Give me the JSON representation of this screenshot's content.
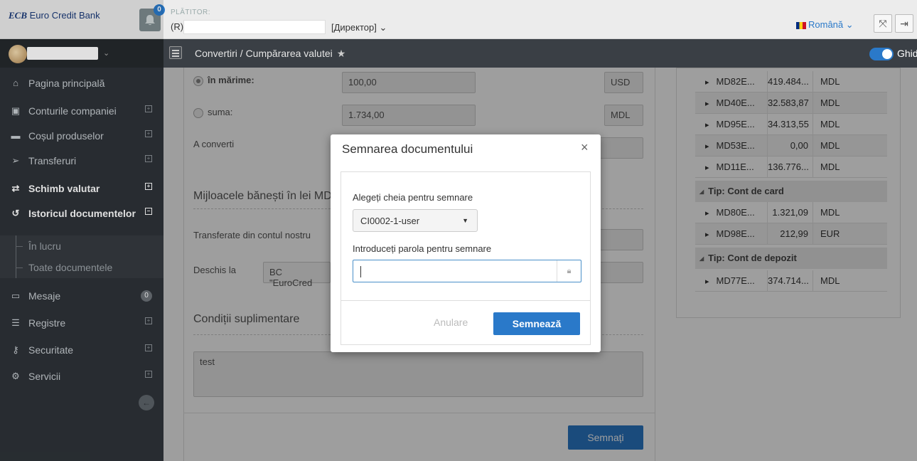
{
  "header": {
    "logo_text": "Euro Credit Bank",
    "notifications_count": "0",
    "payer_label": "PLĂTITOR:",
    "payer_prefix": "(R)",
    "role": "[Директор] ⌄",
    "language": "Română ⌄"
  },
  "sidebar": {
    "items": [
      {
        "icon": "home-icon",
        "label": "Pagina principală"
      },
      {
        "icon": "accounts-icon",
        "label": "Conturile companiei"
      },
      {
        "icon": "briefcase-icon",
        "label": "Coșul produselor"
      },
      {
        "icon": "send-icon",
        "label": "Transferuri"
      },
      {
        "icon": "exchange-icon",
        "label": "Schimb valutar"
      },
      {
        "icon": "history-icon",
        "label": "Istoricul documentelor"
      },
      {
        "icon": "inbox-icon",
        "label": "Mesaje"
      },
      {
        "icon": "list-icon",
        "label": "Registre"
      },
      {
        "icon": "key-icon",
        "label": "Securitate"
      },
      {
        "icon": "cogs-icon",
        "label": "Servicii"
      }
    ],
    "sub_items": [
      "În lucru",
      "Toate documentele"
    ],
    "messages_count": "0"
  },
  "breadcrumb": {
    "path": "Convertiri / Cumpărarea valutei",
    "guide_label": "Ghid"
  },
  "form": {
    "amount_label": "în mărime:",
    "amount_value": "100,00",
    "amount_currency": "USD",
    "sum_label": "suma:",
    "sum_value": "1.734,00",
    "sum_currency": "MDL",
    "convert_label": "A converti",
    "section_funds": "Mijloacele bănești în lei MD",
    "transferred_label": "Transferate din contul nostru",
    "opened_label": "Deschis la",
    "opened_value": "BC \"EuroCred",
    "section_conditions": "Condiții suplimentare",
    "conditions_value": "test",
    "submit_label": "Semnați"
  },
  "accounts": {
    "rows_top": [
      {
        "iban": "MD82E...",
        "amount": "419.484...",
        "currency": "MDL"
      },
      {
        "iban": "MD40E...",
        "amount": "32.583,87",
        "currency": "MDL"
      },
      {
        "iban": "MD95E...",
        "amount": "34.313,55",
        "currency": "MDL"
      },
      {
        "iban": "MD53E...",
        "amount": "0,00",
        "currency": "MDL"
      },
      {
        "iban": "MD11E...",
        "amount": "136.776...",
        "currency": "MDL"
      }
    ],
    "group_card": "Tip: Cont de card",
    "rows_card": [
      {
        "iban": "MD80E...",
        "amount": "1.321,09",
        "currency": "MDL"
      },
      {
        "iban": "MD98E...",
        "amount": "212,99",
        "currency": "EUR"
      }
    ],
    "group_deposit": "Tip: Cont de depozit",
    "rows_deposit": [
      {
        "iban": "MD77E...",
        "amount": "374.714...",
        "currency": "MDL"
      }
    ]
  },
  "modal": {
    "title": "Semnarea documentului",
    "key_label": "Alegeți cheia pentru semnare",
    "key_value": "CI0002-1-user",
    "password_label": "Introduceți parola pentru semnare",
    "cancel_label": "Anulare",
    "sign_label": "Semnează"
  },
  "colors": {
    "accent": "#2a79c9",
    "sidebar": "#2e3338"
  }
}
